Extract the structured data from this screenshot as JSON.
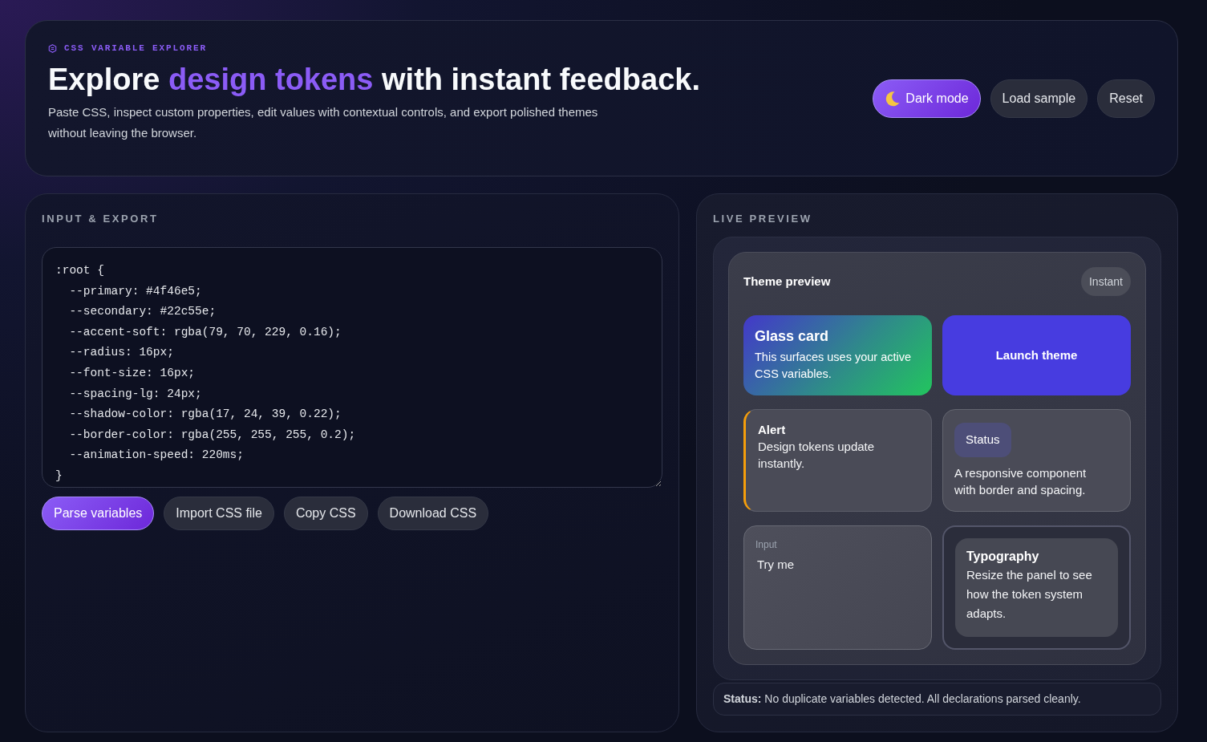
{
  "header": {
    "eyebrow": "CSS VARIABLE EXPLORER",
    "title": [
      {
        "text": "Explore ",
        "highlight": false
      },
      {
        "text": "design tokens",
        "highlight": true
      },
      {
        "text": " with instant feedback.",
        "highlight": false
      }
    ],
    "description": "Paste CSS, inspect custom properties, edit values with contextual controls, and export polished themes without leaving the browser.",
    "actions": [
      {
        "label": "Dark mode",
        "kind": "theme-toggle"
      },
      {
        "label": "Load sample",
        "kind": "secondary"
      },
      {
        "label": "Reset",
        "kind": "secondary"
      }
    ]
  },
  "input_panel": {
    "heading": "INPUT & EXPORT",
    "code": ":root {\n  --primary: #4f46e5;\n  --secondary: #22c55e;\n  --accent-soft: rgba(79, 70, 229, 0.16);\n  --radius: 16px;\n  --font-size: 16px;\n  --spacing-lg: 24px;\n  --shadow-color: rgba(17, 24, 39, 0.22);\n  --border-color: rgba(255, 255, 255, 0.2);\n  --animation-speed: 220ms;\n}",
    "actions": [
      {
        "label": "Parse variables",
        "kind": "primary"
      },
      {
        "label": "Import CSS file",
        "kind": "secondary"
      },
      {
        "label": "Copy CSS",
        "kind": "secondary"
      },
      {
        "label": "Download CSS",
        "kind": "secondary"
      }
    ]
  },
  "preview_panel": {
    "heading": "LIVE PREVIEW",
    "theme_card": {
      "title": "Theme preview",
      "badge": "Instant",
      "tiles": [
        {
          "kind": "glass",
          "title": "Glass card",
          "text": "This surfaces uses your active CSS variables."
        },
        {
          "kind": "button",
          "label": "Launch theme"
        },
        {
          "kind": "alert",
          "title": "Alert",
          "text": "Design tokens update instantly."
        },
        {
          "kind": "status",
          "badge": "Status",
          "text": "A responsive component with border and spacing."
        },
        {
          "kind": "input",
          "label": "Input",
          "value": "Try me"
        },
        {
          "kind": "typography",
          "title": "Typography",
          "text": "Resize the panel to see how the token system adapts."
        }
      ]
    },
    "status": "**Status:** No duplicate variables detected. All declarations parsed cleanly."
  }
}
